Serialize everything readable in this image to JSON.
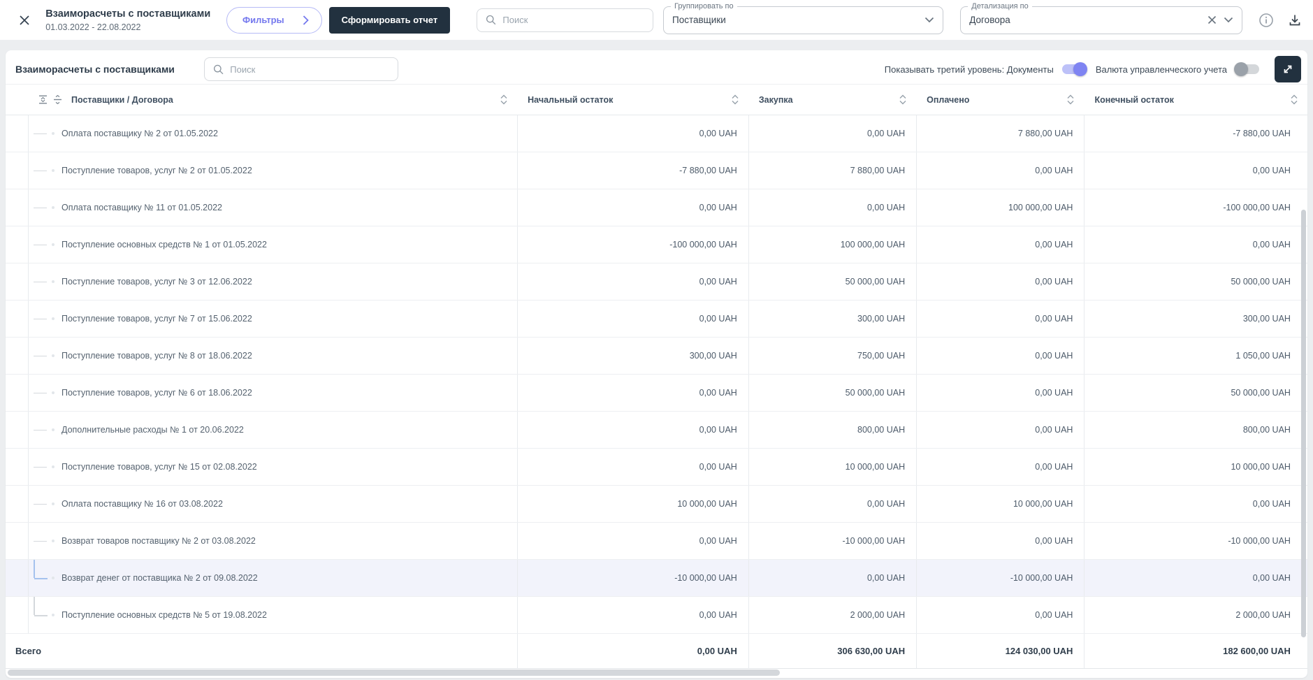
{
  "topbar": {
    "title": "Взаиморасчеты с поставщиками",
    "date_range": "01.03.2022 - 22.08.2022",
    "filters_button": "Фильтры",
    "report_button": "Сформировать отчет",
    "search_placeholder": "Поиск",
    "group_by_label": "Группировать по",
    "group_by_value": "Поставщики",
    "detail_by_label": "Детализация по",
    "detail_by_value": "Договора"
  },
  "panel": {
    "title": "Взаиморасчеты с поставщиками",
    "search_placeholder": "Поиск",
    "third_level_toggle_label": "Показывать третий уровень: Документы",
    "third_level_toggle_state": "on",
    "currency_toggle_label": "Валюта управленческого учета",
    "currency_toggle_state": "off"
  },
  "table": {
    "columns": [
      {
        "label": "Поставщики / Договора"
      },
      {
        "label": "Начальный остаток"
      },
      {
        "label": "Закупка"
      },
      {
        "label": "Оплачено"
      },
      {
        "label": "Конечный остаток"
      }
    ],
    "currency": "UAH",
    "rows": [
      {
        "name": "Оплата поставщику № 2 от 01.05.2022",
        "values": [
          "0,00 UAH",
          "0,00 UAH",
          "7 880,00 UAH",
          "-7 880,00 UAH"
        ],
        "connector": "tee",
        "selected": false
      },
      {
        "name": "Поступление товаров, услуг № 2 от 01.05.2022",
        "values": [
          "-7 880,00 UAH",
          "7 880,00 UAH",
          "0,00 UAH",
          "0,00 UAH"
        ],
        "connector": "tee",
        "selected": false
      },
      {
        "name": "Оплата поставщику № 11 от 01.05.2022",
        "values": [
          "0,00 UAH",
          "0,00 UAH",
          "100 000,00 UAH",
          "-100 000,00 UAH"
        ],
        "connector": "tee",
        "selected": false
      },
      {
        "name": "Поступление основных средств № 1 от 01.05.2022",
        "values": [
          "-100 000,00 UAH",
          "100 000,00 UAH",
          "0,00 UAH",
          "0,00 UAH"
        ],
        "connector": "tee",
        "selected": false
      },
      {
        "name": "Поступление товаров, услуг № 3 от 12.06.2022",
        "values": [
          "0,00 UAH",
          "50 000,00 UAH",
          "0,00 UAH",
          "50 000,00 UAH"
        ],
        "connector": "tee",
        "selected": false
      },
      {
        "name": "Поступление товаров, услуг № 7 от 15.06.2022",
        "values": [
          "0,00 UAH",
          "300,00 UAH",
          "0,00 UAH",
          "300,00 UAH"
        ],
        "connector": "tee",
        "selected": false
      },
      {
        "name": "Поступление товаров, услуг № 8 от 18.06.2022",
        "values": [
          "300,00 UAH",
          "750,00 UAH",
          "0,00 UAH",
          "1 050,00 UAH"
        ],
        "connector": "tee",
        "selected": false
      },
      {
        "name": "Поступление товаров, услуг № 6 от 18.06.2022",
        "values": [
          "0,00 UAH",
          "50 000,00 UAH",
          "0,00 UAH",
          "50 000,00 UAH"
        ],
        "connector": "tee",
        "selected": false
      },
      {
        "name": "Дополнительные расходы № 1 от 20.06.2022",
        "values": [
          "0,00 UAH",
          "800,00 UAH",
          "0,00 UAH",
          "800,00 UAH"
        ],
        "connector": "tee",
        "selected": false
      },
      {
        "name": "Поступление товаров, услуг № 15 от 02.08.2022",
        "values": [
          "0,00 UAH",
          "10 000,00 UAH",
          "0,00 UAH",
          "10 000,00 UAH"
        ],
        "connector": "tee",
        "selected": false
      },
      {
        "name": "Оплата поставщику № 16 от 03.08.2022",
        "values": [
          "10 000,00 UAH",
          "0,00 UAH",
          "10 000,00 UAH",
          "0,00 UAH"
        ],
        "connector": "tee",
        "selected": false
      },
      {
        "name": "Возврат товаров поставщику № 2 от 03.08.2022",
        "values": [
          "0,00 UAH",
          "-10 000,00 UAH",
          "0,00 UAH",
          "-10 000,00 UAH"
        ],
        "connector": "tee",
        "selected": false
      },
      {
        "name": "Возврат денег от поставщика № 2 от 09.08.2022",
        "values": [
          "-10 000,00 UAH",
          "0,00 UAH",
          "-10 000,00 UAH",
          "0,00 UAH"
        ],
        "connector": "elbow",
        "selected": true
      },
      {
        "name": "Поступление основных средств № 5 от 19.08.2022",
        "values": [
          "0,00 UAH",
          "2 000,00 UAH",
          "0,00 UAH",
          "2 000,00 UAH"
        ],
        "connector": "elbow",
        "selected": false
      }
    ],
    "total_label": "Всего",
    "total_values": [
      "0,00 UAH",
      "306 630,00 UAH",
      "124 030,00 UAH",
      "182 600,00 UAH"
    ]
  },
  "colors": {
    "accent_purple": "#7478ee",
    "dark_navy": "#22313f",
    "selected_row_bg": "#f2f3fb",
    "selected_connector": "#a5c2ee"
  }
}
